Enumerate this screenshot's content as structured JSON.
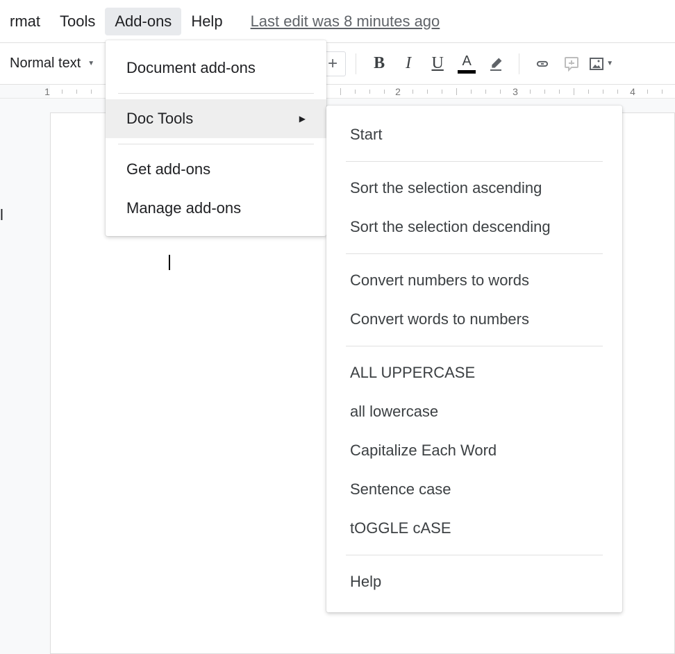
{
  "menubar": {
    "items": [
      "rmat",
      "Tools",
      "Add-ons",
      "Help"
    ],
    "last_edit": "Last edit was 8 minutes ago"
  },
  "toolbar": {
    "styles_label": "Normal text",
    "font_size_plus": "+"
  },
  "addons_menu": {
    "items": [
      "Document add-ons",
      "Doc Tools",
      "Get add-ons",
      "Manage add-ons"
    ]
  },
  "doctools_menu": {
    "items": [
      "Start",
      "Sort the selection ascending",
      "Sort the selection descending",
      "Convert numbers to words",
      "Convert words to numbers",
      "ALL UPPERCASE",
      "all lowercase",
      "Capitalize Each Word",
      "Sentence case",
      "tOGGLE cASE",
      "Help"
    ]
  },
  "ruler": {
    "numbers": [
      "1",
      "2",
      "3",
      "4"
    ]
  },
  "sidebar_fragment": "l"
}
